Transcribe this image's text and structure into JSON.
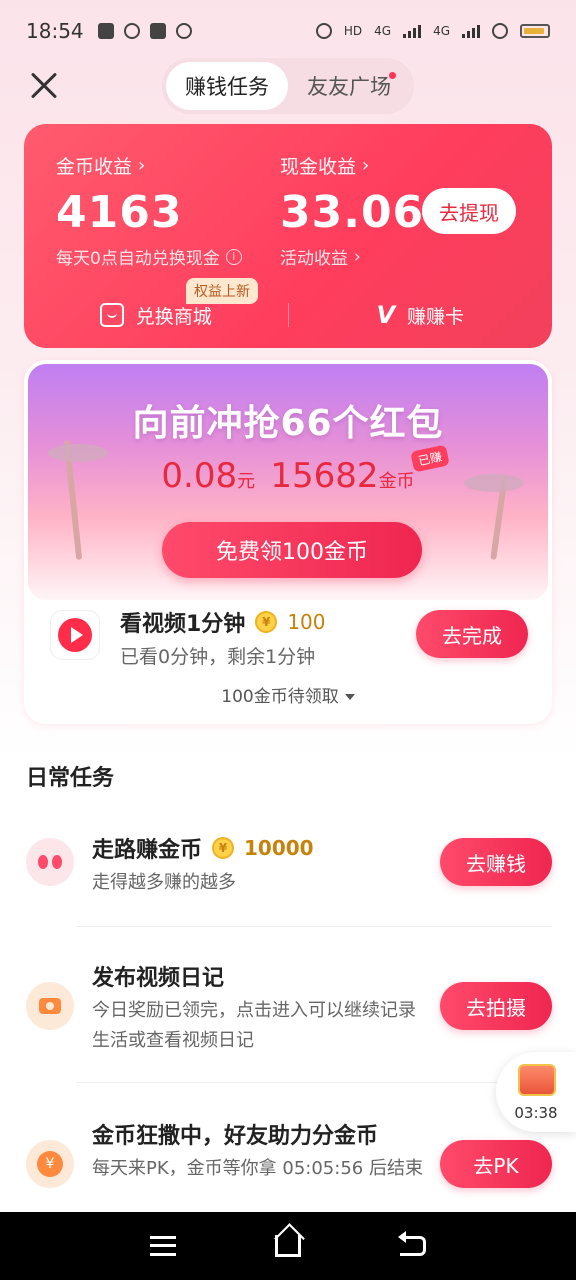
{
  "status_bar": {
    "time": "18:54",
    "network_labels": [
      "HD",
      "4G",
      "4G"
    ]
  },
  "top_tabs": [
    {
      "label": "赚钱任务",
      "active": true
    },
    {
      "label": "友友广场",
      "active": false,
      "has_dot": true
    }
  ],
  "earnings": {
    "coin_label": "金币收益",
    "coin_value": "4163",
    "coin_note": "每天0点自动兑换现金",
    "cash_label": "现金收益",
    "cash_value": "33.06",
    "cash_note": "活动收益",
    "withdraw_label": "去提现",
    "rights_tag": "权益上新",
    "shop_label": "兑换商城",
    "card_label": "赚赚卡"
  },
  "redpack": {
    "title": "向前冲抢66个红包",
    "yuan_value": "0.08",
    "yuan_unit": "元",
    "coin_value": "15682",
    "coin_unit": "金币",
    "earned_tag": "已赚",
    "free_button": "免费领100金币"
  },
  "video_task": {
    "title": "看视频1分钟",
    "coin_amount": "100",
    "subtitle": "已看0分钟，剩余1分钟",
    "button": "去完成",
    "pending": "100金币待领取"
  },
  "daily": {
    "section_title": "日常任务",
    "items": [
      {
        "title": "走路赚金币",
        "coin_amount": "10000",
        "subtitle": "走得越多赚的越多",
        "button": "去赚钱"
      },
      {
        "title": "发布视频日记",
        "subtitle": "今日奖励已领完，点击进入可以继续记录生活或查看视频日记",
        "button": "去拍摄"
      },
      {
        "title": "金币狂撒中，好友助力分金币",
        "subtitle": "每天来PK，金币等你拿 05:05:56 后结束",
        "button": "去PK"
      }
    ]
  },
  "float_box": {
    "time": "03:38"
  },
  "icons": {
    "coin_symbol": "¥",
    "yen_symbol": "¥",
    "chevron": "›",
    "info": "i"
  },
  "colors": {
    "accent": "#ef2650",
    "card_gradient_start": "#ff5b6e",
    "coin_gold": "#c7820b"
  }
}
